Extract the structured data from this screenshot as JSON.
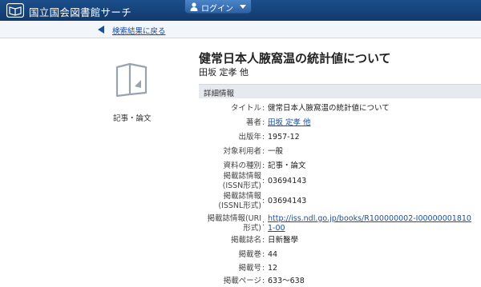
{
  "header": {
    "site_title": "国立国会図書館サーチ",
    "login_label": "ログイン"
  },
  "nav": {
    "back_label": "検索結果に戻る"
  },
  "sidebar": {
    "doc_type": "記事・論文"
  },
  "record": {
    "title": "健常日本人腋窩温の統計値について",
    "authors": "田坂 定孝 他",
    "section_heading": "詳細情報",
    "fields": [
      {
        "label": "タイトル",
        "value": "健常日本人腋窩温の統計値について"
      },
      {
        "label": "著者",
        "value": "田坂 定孝 他"
      },
      {
        "label": "出版年",
        "value": "1957-12"
      },
      {
        "label": "対象利用者",
        "value": "一般"
      },
      {
        "label": "資料の種別",
        "value": "記事・論文"
      },
      {
        "label_line1": "掲載誌情報",
        "label_line2": "(ISSN形式)",
        "value": "03694143"
      },
      {
        "label_line1": "掲載誌情報",
        "label_line2": "(ISSNL形式)",
        "value": "03694143"
      },
      {
        "label_line1": "掲載誌情報(URI",
        "label_line2": "形式)",
        "value": "http://iss.ndl.go.jp/books/R100000002-I000000018101-00"
      },
      {
        "label": "掲載誌名",
        "value": "日新醫學"
      },
      {
        "label": "掲載巻",
        "value": "44"
      },
      {
        "label": "掲載号",
        "value": "12"
      },
      {
        "label": "掲載ページ",
        "value": "633〜638"
      }
    ]
  },
  "icons": {
    "logo": "book-logo-icon",
    "login": "person-icon",
    "login_caret": "caret-down-icon",
    "back": "back-arrow-icon",
    "document": "document-icon"
  },
  "colors": {
    "header_bg": "#1b4e8b",
    "link": "#1a4fa0",
    "section_bg": "#e6e9ed"
  }
}
